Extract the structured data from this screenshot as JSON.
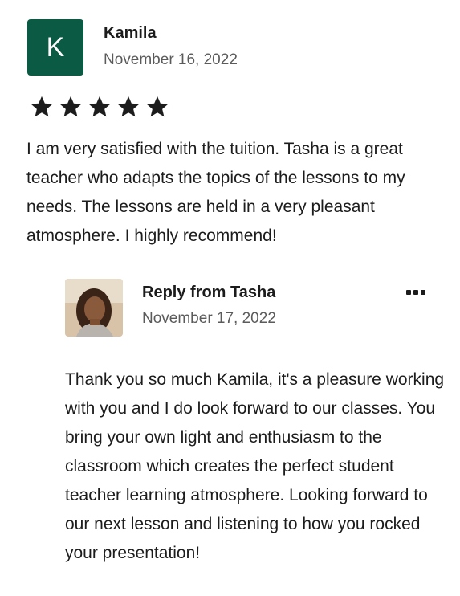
{
  "review": {
    "avatar_letter": "K",
    "reviewer_name": "Kamila",
    "date": "November 16, 2022",
    "rating": 5,
    "rating_max": 5,
    "star_icon": "star-icon",
    "text": "I am very satisfied with the tuition. Tasha is a great teacher who adapts the topics of the lessons to my needs. The lessons are held in a very pleasant atmosphere. I highly recommend!"
  },
  "reply": {
    "title": "Reply from Tasha",
    "date": "November 17, 2022",
    "more_icon": "more-icon",
    "text": "Thank you so much Kamila, it's a pleasure working with you and I do look forward to our classes. You bring your own light and enthusiasm to the classroom which creates the perfect student teacher learning atmosphere. Looking forward to our next lesson and listening to how you rocked your presentation!"
  },
  "colors": {
    "avatar_bg": "#0b5a44",
    "text": "#1c1c1c",
    "muted": "#5b5b5b"
  }
}
